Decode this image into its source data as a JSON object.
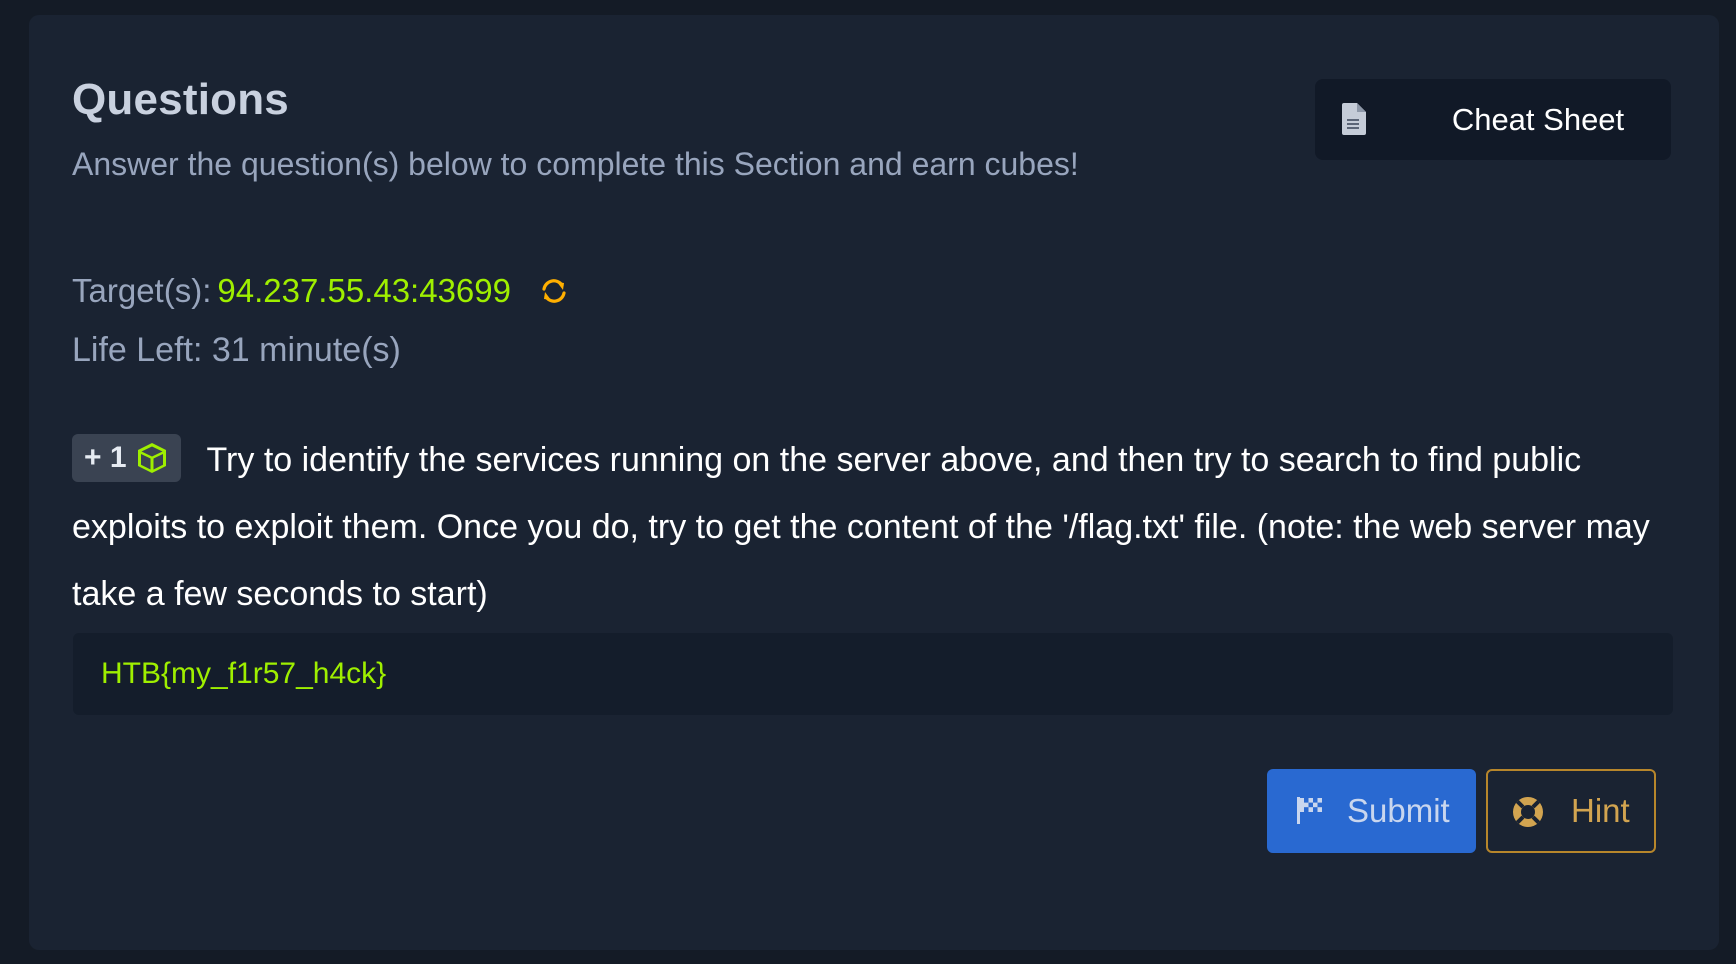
{
  "questions": {
    "title": "Questions",
    "subtitle": "Answer the question(s) below to complete this Section and earn cubes!",
    "cheat_sheet_label": "Cheat Sheet",
    "target_label": "Target(s):",
    "target_value": "94.237.55.43:43699",
    "life_label": "Life Left:",
    "life_value": "31 minute(s)",
    "cube_reward": "+ 1",
    "question_text": "Try to identify the services running on the server above, and then try to search to find public exploits to exploit them. Once you do, try to get the content of the '/flag.txt' file. (note: the web server may take a few seconds to start)",
    "answer_value": "HTB{my_f1r57_h4ck}",
    "submit_label": "Submit",
    "hint_label": "Hint"
  },
  "icons": {
    "cheat_sheet": "document-icon",
    "refresh": "refresh-icon",
    "cube": "cube-icon",
    "submit": "flag-icon",
    "hint": "lifebuoy-icon"
  },
  "colors": {
    "background": "#141b26",
    "panel": "#1a2332",
    "accent_green": "#9fef00",
    "submit_blue": "#2969d1",
    "hint_orange": "#b7862b",
    "refresh_orange": "#ffaf00"
  }
}
